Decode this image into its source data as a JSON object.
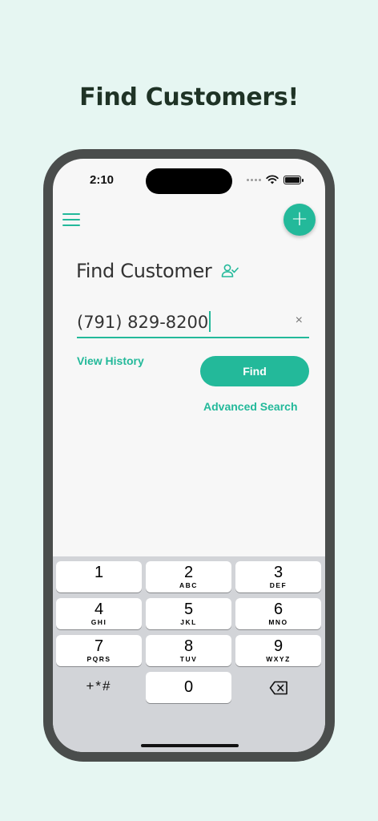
{
  "headline": "Find Customers!",
  "status": {
    "time": "2:10"
  },
  "page": {
    "title": "Find Customer",
    "phone_value": "(791) 829-8200",
    "clear_symbol": "×",
    "add_symbol": "+",
    "view_history": "View History",
    "find_label": "Find",
    "advanced_search": "Advanced Search"
  },
  "keyboard": {
    "keys": [
      {
        "num": "1",
        "letters": ""
      },
      {
        "num": "2",
        "letters": "ABC"
      },
      {
        "num": "3",
        "letters": "DEF"
      },
      {
        "num": "4",
        "letters": "GHI"
      },
      {
        "num": "5",
        "letters": "JKL"
      },
      {
        "num": "6",
        "letters": "MNO"
      },
      {
        "num": "7",
        "letters": "PQRS"
      },
      {
        "num": "8",
        "letters": "TUV"
      },
      {
        "num": "9",
        "letters": "WXYZ"
      },
      {
        "num": "0",
        "letters": ""
      }
    ],
    "symbols_label": "+*#"
  },
  "colors": {
    "accent": "#23b99a",
    "background": "#e6f6f2",
    "headline": "#1f3326"
  },
  "icons": [
    "menu-icon",
    "add-icon",
    "person-check-icon",
    "clear-icon",
    "backspace-icon",
    "wifi-icon",
    "battery-icon"
  ]
}
